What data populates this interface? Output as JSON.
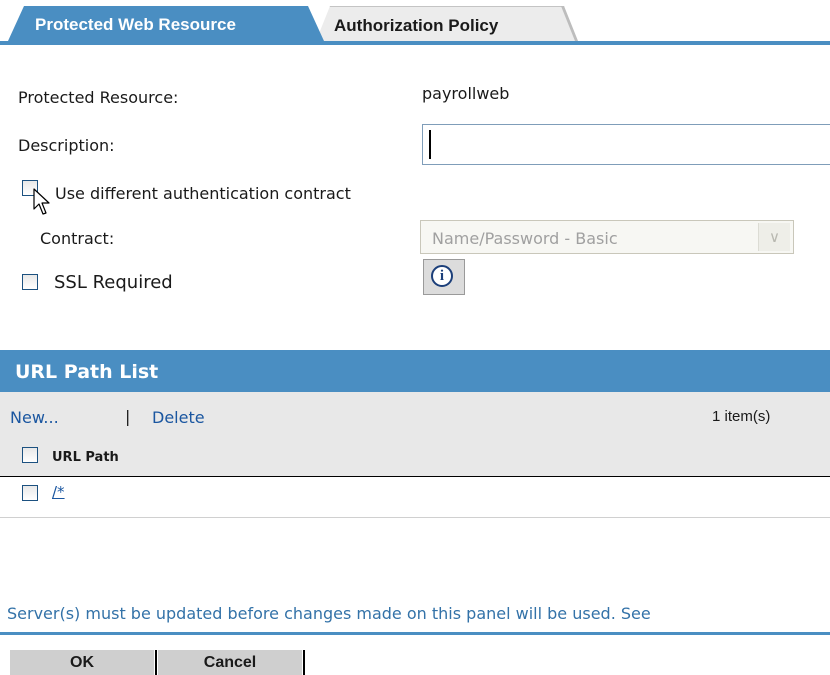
{
  "tabs": [
    {
      "label": "Protected Web Resource",
      "active": true
    },
    {
      "label": "Authorization Policy",
      "active": false
    }
  ],
  "form": {
    "protected_resource_label": "Protected Resource:",
    "protected_resource_value": "payrollweb",
    "description_label": "Description:",
    "description_value": "",
    "use_diff_auth_label": "Use different authentication contract",
    "use_diff_auth_checked": false,
    "contract_label": "Contract:",
    "contract_value": "Name/Password - Basic",
    "ssl_required_label": "SSL Required",
    "ssl_required_checked": false,
    "info_icon": "info-icon"
  },
  "url_path_list": {
    "title": "URL Path List",
    "new_label": "New...",
    "separator": "|",
    "delete_label": "Delete",
    "item_count": "1 item(s)",
    "column_header": "URL Path",
    "rows": [
      {
        "path": "/*",
        "checked": false
      }
    ]
  },
  "footer": {
    "notice": "Server(s) must be updated before changes made on this panel will be used. See",
    "ok_label": "OK",
    "cancel_label": "Cancel"
  },
  "colors": {
    "accent": "#4a8ec2",
    "link": "#1a56a0",
    "notice_text": "#3372a8"
  }
}
